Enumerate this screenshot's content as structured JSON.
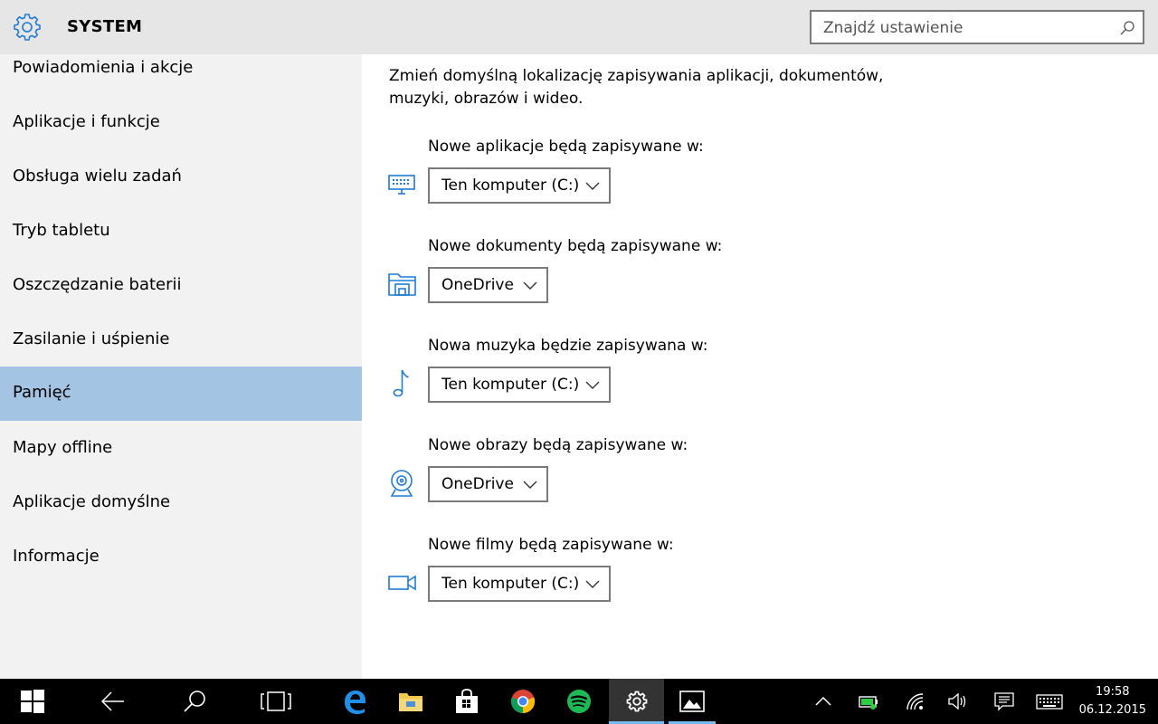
{
  "header": {
    "title": "SYSTEM",
    "search_placeholder": "Znajdź ustawienie"
  },
  "sidebar": {
    "items": [
      {
        "label": "Powiadomienia i akcje"
      },
      {
        "label": "Aplikacje i funkcje"
      },
      {
        "label": "Obsługa wielu zadań"
      },
      {
        "label": "Tryb tabletu"
      },
      {
        "label": "Oszczędzanie baterii"
      },
      {
        "label": "Zasilanie i uśpienie"
      },
      {
        "label": "Pamięć",
        "active": true
      },
      {
        "label": "Mapy offline"
      },
      {
        "label": "Aplikacje domyślne"
      },
      {
        "label": "Informacje"
      }
    ]
  },
  "main": {
    "intro_line1": "Zmień domyślną lokalizację zapisywania aplikacji, dokumentów,",
    "intro_line2": "muzyki, obrazów i wideo.",
    "rows": [
      {
        "label": "Nowe aplikacje będą zapisywane w:",
        "value": "Ten komputer (C:)",
        "icon": "monitor-icon"
      },
      {
        "label": "Nowe dokumenty będą zapisywane w:",
        "value": "OneDrive",
        "icon": "document-folder-icon"
      },
      {
        "label": "Nowa muzyka będzie zapisywana w:",
        "value": "Ten komputer (C:)",
        "icon": "music-note-icon"
      },
      {
        "label": "Nowe obrazy będą zapisywane w:",
        "value": "OneDrive",
        "icon": "camera-icon"
      },
      {
        "label": "Nowe filmy będą zapisywane w:",
        "value": "Ten komputer (C:)",
        "icon": "video-camera-icon"
      }
    ]
  },
  "taskbar": {
    "time": "19:58",
    "date": "06.12.2015"
  },
  "colors": {
    "accent_blue": "#1f7bd6",
    "selected_nav": "#a4c4e4",
    "taskbar_highlight": "#76b9ed"
  }
}
